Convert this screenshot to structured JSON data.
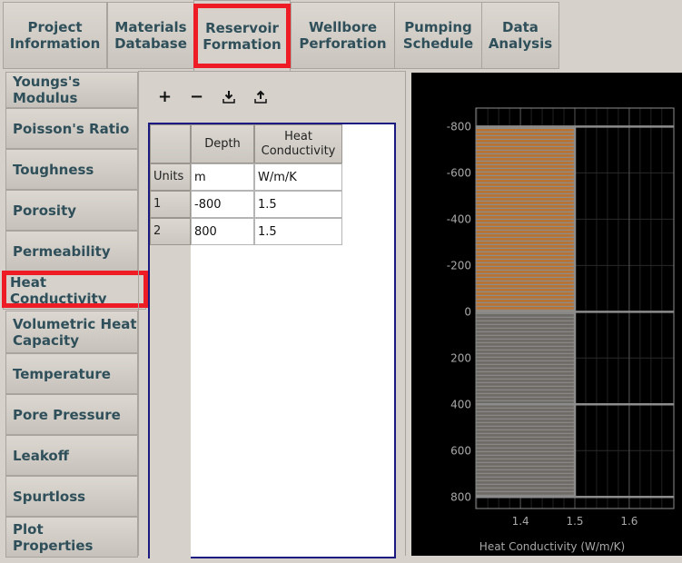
{
  "top_tabs": [
    {
      "label": "Project\nInformation"
    },
    {
      "label": "Materials\nDatabase"
    },
    {
      "label": "Reservoir\nFormation",
      "selected": true
    },
    {
      "label": "Wellbore\nPerforation"
    },
    {
      "label": "Pumping\nSchedule"
    },
    {
      "label": "Data\nAnalysis"
    }
  ],
  "side_tabs": [
    {
      "label": "Youngs's Modulus"
    },
    {
      "label": "Poisson's Ratio"
    },
    {
      "label": "Toughness"
    },
    {
      "label": "Porosity"
    },
    {
      "label": "Permeability"
    },
    {
      "label": "Heat Conductivity",
      "selected": true
    },
    {
      "label": "Volumetric Heat Capacity"
    },
    {
      "label": "Temperature"
    },
    {
      "label": "Pore Pressure"
    },
    {
      "label": "Leakoff"
    },
    {
      "label": "Spurtloss"
    },
    {
      "label": "Plot\nProperties"
    }
  ],
  "toolbar": {
    "add": "+",
    "remove": "−",
    "import_icon": "import-icon",
    "export_icon": "export-icon"
  },
  "table": {
    "columns": [
      "Depth",
      "Heat\nConductivity"
    ],
    "rows": [
      {
        "header": "Units",
        "cells": [
          "m",
          "W/m/K"
        ]
      },
      {
        "header": "1",
        "cells": [
          "-800",
          "1.5"
        ]
      },
      {
        "header": "2",
        "cells": [
          "800",
          "1.5"
        ]
      }
    ]
  },
  "chart_data": {
    "type": "bar",
    "orientation": "horizontal-step",
    "xlabel": "Heat Conductivity (W/m/K)",
    "ylabel": "",
    "xlim": [
      1.318,
      1.682
    ],
    "ylim": [
      -880,
      850
    ],
    "y_inverted": true,
    "xticks": [
      "1.4",
      "1.5",
      "1.6"
    ],
    "yticks": [
      "-800",
      "-600",
      "-400",
      "-200",
      "0",
      "200",
      "400",
      "600",
      "800"
    ],
    "grid": true,
    "layers": [
      {
        "depth_top": -800,
        "depth_bottom": 0,
        "value": 1.5,
        "color": "#b87333"
      },
      {
        "depth_top": 0,
        "depth_bottom": 800,
        "value": 1.5,
        "color": "#6e6a66"
      }
    ],
    "boundaries": [
      -800,
      0,
      400,
      800
    ],
    "colors": {
      "background": "#000000",
      "axis": "#8c8c8c",
      "text": "#a8a8a8"
    }
  }
}
